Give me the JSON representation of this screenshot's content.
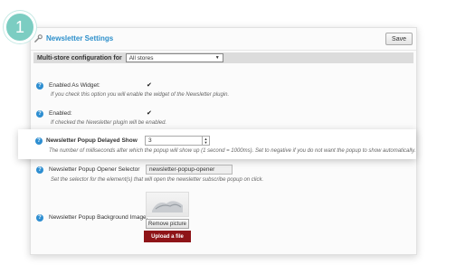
{
  "step": {
    "number": "1"
  },
  "panel": {
    "title": "Newsletter Settings",
    "save_label": "Save"
  },
  "store_bar": {
    "label": "Multi-store configuration for",
    "selected": "All stores"
  },
  "fields": {
    "enabled_as_widget": {
      "label": "Enabled As Widget:",
      "help": "If you check this option you will enable the widget of the Newsletter plugin.",
      "checked_mark": "✔"
    },
    "enabled": {
      "label": "Enabled:",
      "help": "If checked the Newsletter plugin will be enabled.",
      "checked_mark": "✔"
    },
    "delayed_show": {
      "label": "Newsletter Popup Delayed Show",
      "value": "3",
      "help": "The number of milliseconds after which the popup will show up (1 second = 1000ms). Set to negative if you do not want the popup to show automatically."
    },
    "opener_selector": {
      "label": "Newsletter Popup Opener Selector",
      "value": "newsletter-popup-opener",
      "help": "Set the selector for the element(s) that will open the newsletter subscribe popup on click."
    },
    "background_image": {
      "label": "Newsletter Popup Background Image:",
      "remove_label": "Remove picture",
      "upload_label": "Upload a file"
    }
  },
  "colors": {
    "accent": "#2c8fcb",
    "badge": "#7ccdc2",
    "upload": "#8e1418"
  }
}
